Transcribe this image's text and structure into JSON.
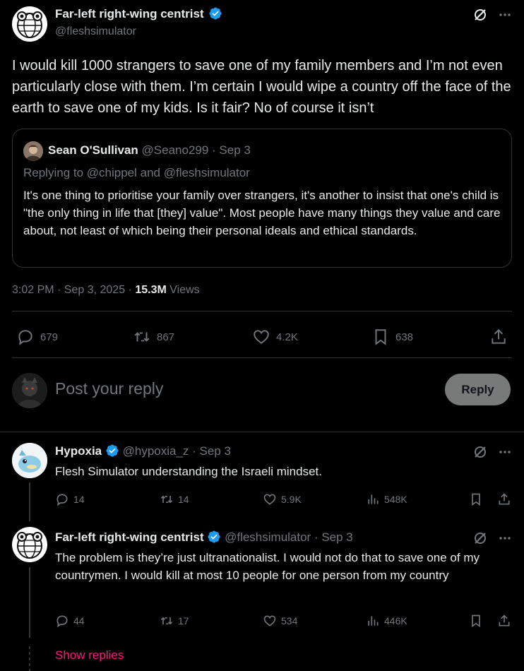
{
  "main_tweet": {
    "author_name": "Far-left right-wing centrist",
    "handle": "@fleshsimulator",
    "text": "I would kill 1000 strangers to save one of my family members and I’m not even particularly close with them. I’m certain I would wipe a country off the face of the earth to save one of my kids. Is it fair? No of course it isn’t",
    "timestamp": "3:02 PM · Sep 3, 2025 · ",
    "views_count": "15.3M",
    "views_label": " Views",
    "stats": {
      "replies": "679",
      "reposts": "867",
      "likes": "4.2K",
      "bookmarks": "638"
    }
  },
  "quoted_tweet": {
    "author_name": "Sean O'Sullivan",
    "handle_date": "@Seano299 · Sep 3",
    "replying_to": "Replying to @chippel and @fleshsimulator",
    "text": "It's one thing to prioritise your family over strangers, it's another to insist that one's child is \"the only thing in life that [they] value\". Most people have many things they value and care about, not least of which being their personal ideals and ethical standards."
  },
  "reply_box": {
    "placeholder": "Post your reply",
    "button_label": "Reply"
  },
  "replies": [
    {
      "author_name": "Hypoxia",
      "handle_date": "@hypoxia_z · Sep 3",
      "text": "Flesh Simulator understanding the Israeli mindset.",
      "stats": {
        "replies": "14",
        "reposts": "14",
        "likes": "5.9K",
        "views": "548K"
      }
    },
    {
      "author_name": "Far-left right-wing centrist",
      "handle_date": "@fleshsimulator · Sep 3",
      "text": "The problem is they’re just ultranationalist. I would not do that to save one of my countrymen. I would kill at most 10 people for one person from my country",
      "stats": {
        "replies": "44",
        "reposts": "17",
        "likes": "534",
        "views": "446K"
      }
    }
  ],
  "show_replies_label": "Show replies",
  "colors": {
    "accent": "#1d9bf0",
    "show_replies": "#f91880",
    "background": "#000000"
  }
}
